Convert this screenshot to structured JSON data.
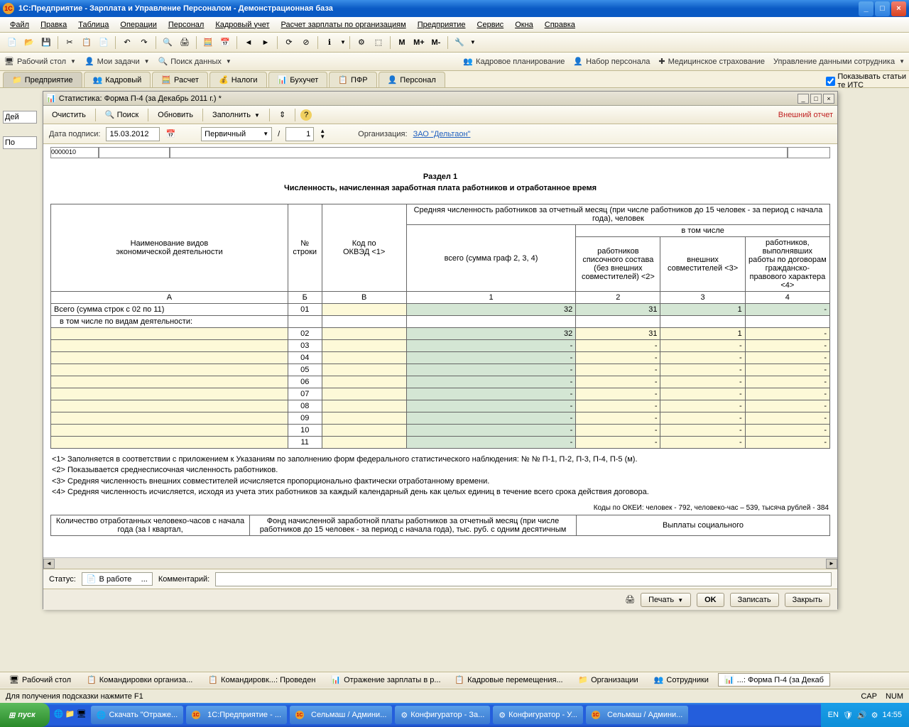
{
  "titlebar": {
    "text": "1С:Предприятие - Зарплата и Управление Персоналом - Демонстрационная база"
  },
  "menubar": [
    "Файл",
    "Правка",
    "Таблица",
    "Операции",
    "Персонал",
    "Кадровый учет",
    "Расчет зарплаты по организациям",
    "Предприятие",
    "Сервис",
    "Окна",
    "Справка"
  ],
  "toolbar2": {
    "left": [
      "Рабочий стол",
      "Мои задачи",
      "Поиск данных"
    ],
    "right": [
      "Кадровое планирование",
      "Набор персонала",
      "Медицинское страхование",
      "Управление данными сотрудника"
    ]
  },
  "tabs_back": "Предприятие",
  "tabs": [
    "Кадровый",
    "Расчет",
    "Налоги",
    "Бухучет",
    "ПФР",
    "Персонал"
  ],
  "show_stats": "Показывать статьи\nте ИТС",
  "left_panel": {
    "l1": "Дей",
    "l2": "По"
  },
  "window": {
    "title": "Статистика: Форма П-4 (за Декабрь 2011 г.) *",
    "toolbar": {
      "clear": "Очистить",
      "search": "Поиск",
      "refresh": "Обновить",
      "fill": "Заполнить",
      "ext": "Внешний отчет"
    },
    "params": {
      "date_label": "Дата подписи:",
      "date_value": "15.03.2012",
      "primary": "Первичный",
      "slash": "/",
      "num": "1",
      "org_label": "Организация:",
      "org_value": "ЗАО \"Дельтаон\""
    },
    "top_code": "0000010",
    "section_num": "Раздел 1",
    "section_title": "Численность, начисленная заработная плата работников и отработанное время",
    "headers": {
      "h1": "Наименование видов\nэкономической деятельности",
      "h2": "№\nстроки",
      "h3": "Код по\nОКВЭД <1>",
      "h4": "Средняя численность работников за отчетный месяц (при числе работников до 15 человек - за период с начала года), человек",
      "h5": "всего (сумма граф 2, 3, 4)",
      "h6": "в том числе",
      "h7": "работников списочного состава (без внешних совместителей) <2>",
      "h8": "внешних совместителей <3>",
      "h9": "работников, выполнявших работы по договорам гражданско-правового характера <4>",
      "colA": "А",
      "colB": "Б",
      "colV": "В",
      "col1": "1",
      "col2": "2",
      "col3": "3",
      "col4": "4"
    },
    "rows": {
      "total_label": "Всего (сумма строк с 02 по 11)",
      "total_num": "01",
      "total_v1": "32",
      "total_v2": "31",
      "total_v3": "1",
      "total_v4": "-",
      "sub_label": "в том числе по видам деятельности:",
      "r02": {
        "n": "02",
        "v1": "32",
        "v2": "31",
        "v3": "1",
        "v4": "-"
      },
      "r03": {
        "n": "03",
        "v1": "-",
        "v2": "-",
        "v3": "-",
        "v4": "-"
      },
      "r04": {
        "n": "04",
        "v1": "-",
        "v2": "-",
        "v3": "-",
        "v4": "-"
      },
      "r05": {
        "n": "05",
        "v1": "-",
        "v2": "-",
        "v3": "-",
        "v4": "-"
      },
      "r06": {
        "n": "06",
        "v1": "-",
        "v2": "-",
        "v3": "-",
        "v4": "-"
      },
      "r07": {
        "n": "07",
        "v1": "-",
        "v2": "-",
        "v3": "-",
        "v4": "-"
      },
      "r08": {
        "n": "08",
        "v1": "-",
        "v2": "-",
        "v3": "-",
        "v4": "-"
      },
      "r09": {
        "n": "09",
        "v1": "-",
        "v2": "-",
        "v3": "-",
        "v4": "-"
      },
      "r10": {
        "n": "10",
        "v1": "-",
        "v2": "-",
        "v3": "-",
        "v4": "-"
      },
      "r11": {
        "n": "11",
        "v1": "-",
        "v2": "-",
        "v3": "-",
        "v4": "-"
      }
    },
    "notes": {
      "n1": "<1> Заполняется в соответствии с приложением к Указаниям по заполнению форм федерального статистического наблюдения: № № П-1, П-2, П-3, П-4, П-5 (м).",
      "n2": "<2> Показывается среднесписочная численность работников.",
      "n3": "<3> Средняя численность внешних совместителей исчисляется пропорционально фактически отработанному времени.",
      "n4": "<4> Средняя численность исчисляется, исходя из учета этих работников за каждый календарный день как целых единиц в течение всего срока действия договора."
    },
    "okei": "Коды по ОКЕИ: человек - 792, человеко-час – 539, тысяча рублей - 384",
    "table2": {
      "h1": "Количество отработанных человеко-часов с начала года (за I квартал,",
      "h2": "Фонд начисленной заработной платы работников за отчетный месяц (при числе работников до 15 человек - за период с начала года), тыс. руб. с одним десятичным",
      "h3": "Выплаты социального"
    },
    "status": {
      "label": "Статус:",
      "value": "В работе",
      "comment_label": "Комментарий:"
    },
    "buttons": {
      "print": "Печать",
      "ok": "OK",
      "save": "Записать",
      "close": "Закрыть"
    }
  },
  "app_tasks": [
    "Рабочий стол",
    "Командировки организа...",
    "Командировк...: Проведен",
    "Отражение зарплаты в р...",
    "Кадровые перемещения...",
    "Организации",
    "Сотрудники",
    "...: Форма П-4 (за Декаб"
  ],
  "app_status": {
    "hint": "Для получения подсказки нажмите F1",
    "cap": "CAP",
    "num": "NUM"
  },
  "win_taskbar": {
    "start": "пуск",
    "tasks": [
      "Скачать \"Отраже...",
      "1С:Предприятие - ...",
      "Сельмаш / Админи...",
      "Конфигуратор - За...",
      "Конфигуратор - У...",
      "Сельмаш / Админи..."
    ],
    "lang": "EN",
    "time": "14:55"
  }
}
